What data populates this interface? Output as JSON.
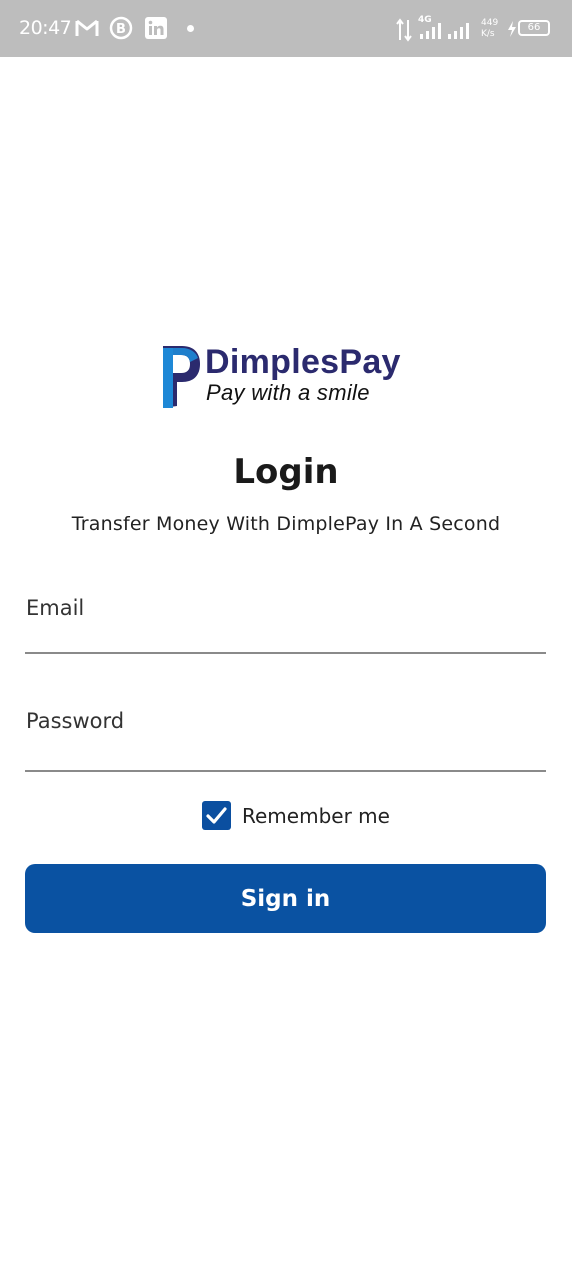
{
  "status_bar": {
    "time": "20:47",
    "network_type": "4G",
    "speed_value": "449",
    "speed_unit": "K/s",
    "battery": "66"
  },
  "brand": {
    "name": "DimplesPay",
    "tagline": "Pay with a smile",
    "colors": {
      "logo_dark": "#2b2a6e",
      "logo_blue": "#1e88d6"
    }
  },
  "login": {
    "title": "Login",
    "subtitle": "Transfer Money With DimplePay In A Second",
    "email_label": "Email",
    "email_value": "",
    "password_label": "Password",
    "password_value": "",
    "remember_label": "Remember me",
    "remember_checked": true,
    "signin_label": "Sign in"
  },
  "colors": {
    "primary": "#0a52a2",
    "status_bar": "#bdbdbd"
  },
  "icons": [
    "gmail-icon",
    "b-icon",
    "linkedin-icon",
    "data-arrows-icon",
    "signal-icon",
    "battery-icon",
    "checkmark-icon"
  ]
}
